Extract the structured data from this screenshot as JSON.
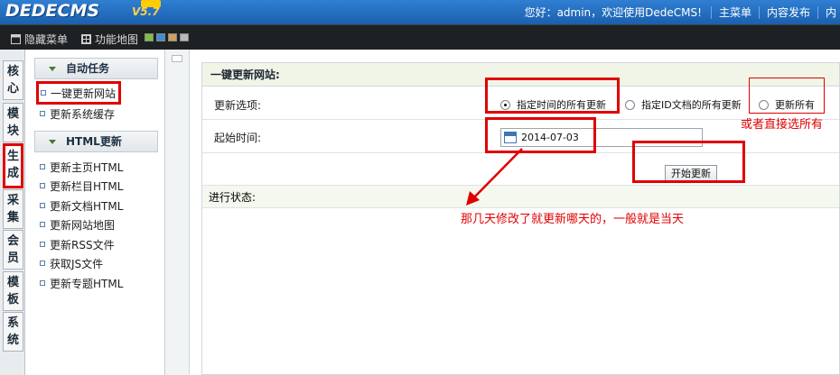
{
  "header": {
    "logo": "DEDECMS",
    "version": "V5.7",
    "welcome": "您好：admin，欢迎使用DedeCMS!",
    "nav_links": [
      "主菜单",
      "内容发布",
      "内"
    ]
  },
  "toolbar": {
    "hide_menu": "隐藏菜单",
    "site_map": "功能地图",
    "theme_colors": [
      "#7fbf3f",
      "#3d8fd6",
      "#c9a25e",
      "#b8b8b8"
    ]
  },
  "side_tabs": [
    {
      "label": "核心",
      "active": false
    },
    {
      "label": "模块",
      "active": false
    },
    {
      "label": "生成",
      "active": true
    },
    {
      "label": "采集",
      "active": false
    },
    {
      "label": "会员",
      "active": false
    },
    {
      "label": "模板",
      "active": false
    },
    {
      "label": "系统",
      "active": false
    }
  ],
  "menu": {
    "group1_title": "自动任务",
    "group1_items": [
      "一键更新网站",
      "更新系统缓存"
    ],
    "group2_title": "HTML更新",
    "group2_items": [
      "更新主页HTML",
      "更新栏目HTML",
      "更新文档HTML",
      "更新网站地图",
      "更新RSS文件",
      "获取JS文件",
      "更新专题HTML"
    ]
  },
  "main": {
    "title": "一键更新网站:",
    "options_label": "更新选项:",
    "option1": "指定时间的所有更新",
    "option2": "指定ID文档的所有更新",
    "option3": "更新所有",
    "selected_option": "指定时间的所有更新",
    "start_time_label": "起始时间:",
    "start_time_value": "2014-07-03",
    "start_button": "开始更新",
    "status_label": "进行状态:"
  },
  "annotations": {
    "note_select_all": "或者直接选所有",
    "note_date": "那几天修改了就更新哪天的，一般就是当天",
    "color": "#e00000"
  }
}
